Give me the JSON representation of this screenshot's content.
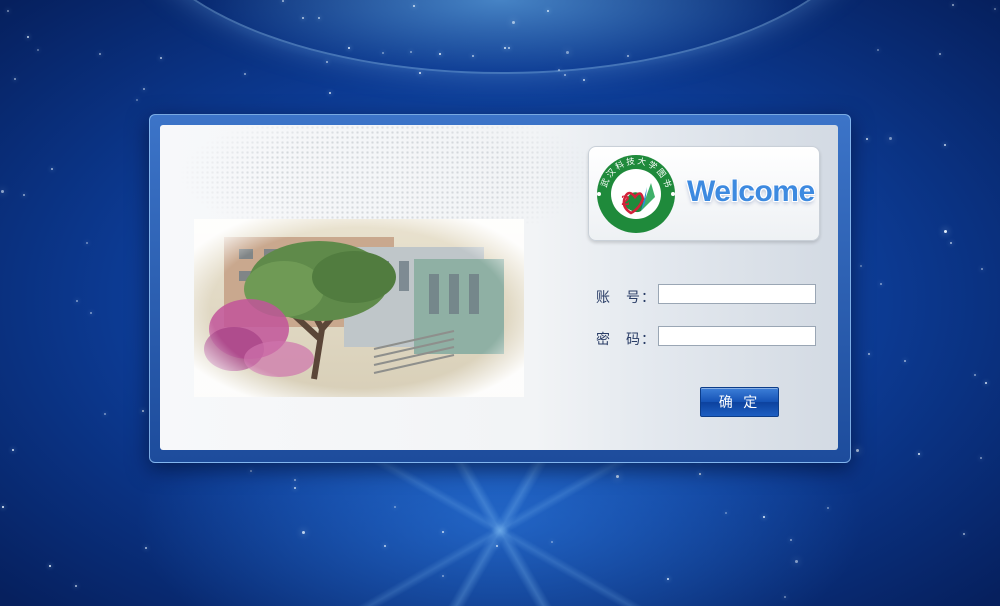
{
  "login": {
    "welcome_text": "Welcome",
    "school_seal_text": "武汉科技大学图书馆",
    "account_label": "账　号：",
    "account_value": "",
    "password_label": "密　码：",
    "password_value": "",
    "submit_label": "确 定"
  },
  "icons": {
    "seal": "school-seal-icon"
  },
  "colors": {
    "background": "#0c3a92",
    "welcome_text": "#3d8ae0",
    "button": "#1552b5",
    "seal_green": "#1f8a3b"
  }
}
